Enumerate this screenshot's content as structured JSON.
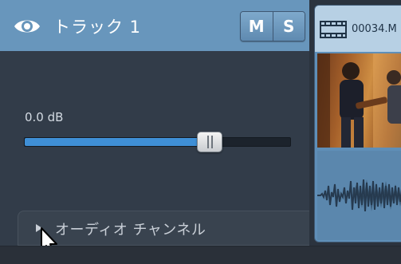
{
  "track": {
    "name": "トラック 1",
    "mute_label": "M",
    "solo_label": "S"
  },
  "mixer": {
    "volume_label": "0.0 dB",
    "volume_fraction": 0.7
  },
  "channels": {
    "label": "オーディオ チャンネル"
  },
  "clip": {
    "title": "00034.M"
  },
  "colors": {
    "header": "#6896bc",
    "panel": "#323c49",
    "slider_fill": "#3f8fd6",
    "clip": "#5f8fb8"
  }
}
